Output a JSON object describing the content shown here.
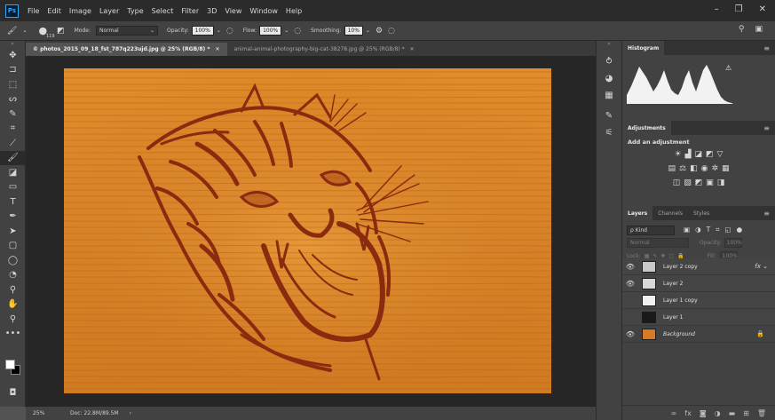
{
  "app": {
    "logo": "Ps"
  },
  "menu": [
    "File",
    "Edit",
    "Image",
    "Layer",
    "Type",
    "Select",
    "Filter",
    "3D",
    "View",
    "Window",
    "Help"
  ],
  "window_controls": [
    "–",
    "❐",
    "✕"
  ],
  "options": {
    "brush_size": "119",
    "mode_label": "Mode:",
    "mode_value": "Normal",
    "opacity_label": "Opacity:",
    "opacity_value": "100%",
    "flow_label": "Flow:",
    "flow_value": "100%",
    "smoothing_label": "Smoothing:",
    "smoothing_value": "10%"
  },
  "tabs": [
    {
      "label": "© photos_2015_09_18_fst_787q223ujd.jpg @ 25% (RGB/8) *",
      "close": "✕",
      "active": true
    },
    {
      "label": "animal-animal-photography-big-cat-38278.jpg @ 25% (RGB/8) *",
      "close": "✕",
      "active": false
    }
  ],
  "tools": [
    {
      "name": "move-tool",
      "glyph": "✥"
    },
    {
      "name": "artboard-tool",
      "glyph": "⊐"
    },
    {
      "name": "marquee-tool",
      "glyph": "⬚"
    },
    {
      "name": "lasso-tool",
      "glyph": "ᔕ"
    },
    {
      "name": "quick-select-tool",
      "glyph": "✎"
    },
    {
      "name": "crop-tool",
      "glyph": "⌗"
    },
    {
      "name": "eyedropper-tool",
      "glyph": "⟋"
    },
    {
      "name": "brush-tool",
      "glyph": "🖌"
    },
    {
      "name": "eraser-tool",
      "glyph": "◪"
    },
    {
      "name": "gradient-tool",
      "glyph": "▭"
    },
    {
      "name": "type-tool",
      "glyph": "T"
    },
    {
      "name": "pen-tool",
      "glyph": "✒"
    },
    {
      "name": "path-select-tool",
      "glyph": "➤"
    },
    {
      "name": "rectangle-tool",
      "glyph": "▢"
    },
    {
      "name": "blur-tool",
      "glyph": "◯"
    },
    {
      "name": "dodge-tool",
      "glyph": "◔"
    },
    {
      "name": "stamp-tool",
      "glyph": "⚲"
    },
    {
      "name": "hand-tool",
      "glyph": "✋"
    },
    {
      "name": "zoom-tool",
      "glyph": "⚲"
    },
    {
      "name": "more-tools",
      "glyph": "•••"
    }
  ],
  "status": {
    "zoom": "25%",
    "doc": "Doc: 22.8M/89.5M",
    "arrow": "›"
  },
  "dock_icons": [
    "history-icon",
    "color-icon",
    "swatches-icon",
    "brush-presets-icon",
    "properties-icon"
  ],
  "histogram": {
    "title": "Histogram",
    "warning": "⚠"
  },
  "adjustments": {
    "title": "Adjustments",
    "subtitle": "Add an adjustment"
  },
  "layers": {
    "tabs": [
      "Layers",
      "Channels",
      "Styles"
    ],
    "kind": "ρ Kind",
    "blend": "Normal",
    "opacity_label": "Opacity:",
    "opacity_value": "100%",
    "lock_label": "Lock:",
    "fill_label": "Fill:",
    "fill_value": "100%",
    "items": [
      {
        "name": "Layer 2 copy",
        "visible": true,
        "thumb": "#c8c8c8",
        "fx": "fx ⌄"
      },
      {
        "name": "Layer 2",
        "visible": true,
        "thumb": "#d8d8d8"
      },
      {
        "name": "Layer 1 copy",
        "visible": false,
        "thumb": "#f0f0f0"
      },
      {
        "name": "Layer 1",
        "visible": false,
        "thumb": "#1a1a1a"
      },
      {
        "name": "Background",
        "visible": true,
        "thumb": "#d77a22",
        "italic": true,
        "lock": "🔒"
      }
    ]
  },
  "colors": {
    "wood": "#d98a2e",
    "carving": "#8c2a10",
    "accent": "#31a8ff"
  }
}
